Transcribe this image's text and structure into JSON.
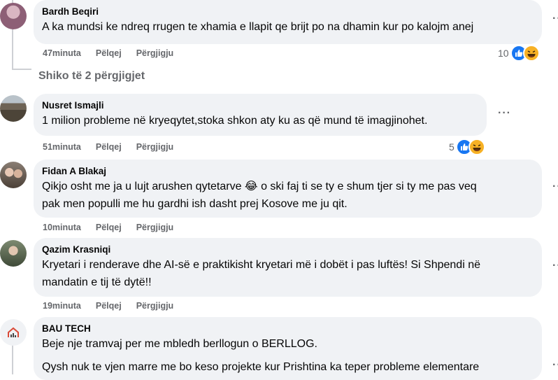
{
  "comments": [
    {
      "author": "Bardh Beqiri",
      "text": "A ka mundsi ke ndreq rrugen te xhamia e llapit qe brijt po na dhamin kur po kalojm anej",
      "time": "47minuta",
      "like": "Pëlqej",
      "reply": "Përgjigju",
      "reaction_count": "10"
    },
    {
      "author": "Nusret Ismajli",
      "text": "1 milion probleme në kryeqytet,stoka shkon aty ku as që mund të imagjinohet.",
      "time": "51minuta",
      "like": "Pëlqej",
      "reply": "Përgjigju",
      "reaction_count": "5"
    },
    {
      "author": "Fidan A Blakaj",
      "text_part1": "Qikjo osht me ja u lujt arushen qytetarve ",
      "emoji": "😂",
      "text_part2": " o ski faj ti se ty e shum tjer si ty me pas veq",
      "text_line2": "pak men populli me hu gardhi ish dasht prej Kosove me ju qit.",
      "time": "10minuta",
      "like": "Pëlqej",
      "reply": "Përgjigju"
    },
    {
      "author": "Qazim Krasniqi",
      "text_line1": "Kryetari i renderave dhe AI-së e praktikisht kryetari më i dobët i pas luftës! Si Shpendi në",
      "text_line2": "mandatin e tij të dytë!!",
      "time": "19minuta",
      "like": "Pëlqej",
      "reply": "Përgjigju"
    },
    {
      "author": "BAU TECH",
      "text_line1": "Beje nje tramvaj per me mbledh berllogun o BERLLOG.",
      "text_line2": "Qysh nuk te vjen marre me bo keso projekte kur Prishtina ka teper probleme elementare"
    }
  ],
  "view_replies": "Shiko të 2 përgjigjet",
  "more_glyph": "···",
  "colors": {
    "bubble": "#f0f2f5",
    "meta": "#65676b",
    "like_blue": "#1877f2",
    "haha_yellow": "#f7b125",
    "thread": "#ced0d4"
  },
  "icons": [
    "avatar",
    "like-icon",
    "haha-icon",
    "more-options-icon",
    "reply-thread-connector"
  ]
}
